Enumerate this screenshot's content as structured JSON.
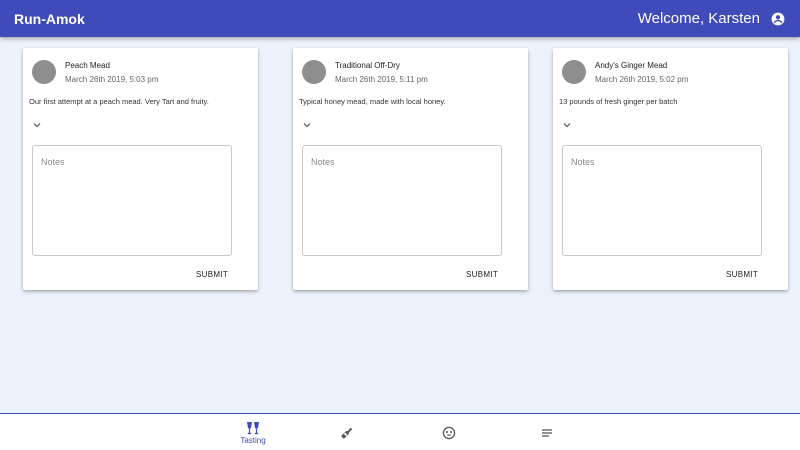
{
  "header": {
    "title": "Run-Amok",
    "welcome": "Welcome, Karsten",
    "account_icon": "account-circle-icon"
  },
  "cards": [
    {
      "title": "Peach Mead",
      "date": "March 26th 2019, 5:03 pm",
      "description": "Our first attempt at a peach mead. Very Tart and fruity.",
      "notes_placeholder": "Notes",
      "submit_label": "SUBMIT"
    },
    {
      "title": "Traditional Off-Dry",
      "date": "March 26th 2019, 5:11 pm",
      "description": "Typical honey mead, made with local honey.",
      "notes_placeholder": "Notes",
      "submit_label": "SUBMIT"
    },
    {
      "title": "Andy's Ginger Mead",
      "date": "March 26th 2019, 5:02 pm",
      "description": "13 pounds of fresh ginger per batch",
      "notes_placeholder": "Notes",
      "submit_label": "SUBMIT"
    }
  ],
  "bottom_nav": {
    "items": [
      {
        "label": "Tasting",
        "icon": "glasses-icon",
        "active": true
      },
      {
        "label": "",
        "icon": "bottle-icon",
        "active": false
      },
      {
        "label": "",
        "icon": "emoji-icon",
        "active": false
      },
      {
        "label": "",
        "icon": "list-icon",
        "active": false
      }
    ]
  },
  "colors": {
    "primary": "#3f4bb8",
    "background": "#edf3fd",
    "avatar": "#8e8e8e"
  }
}
